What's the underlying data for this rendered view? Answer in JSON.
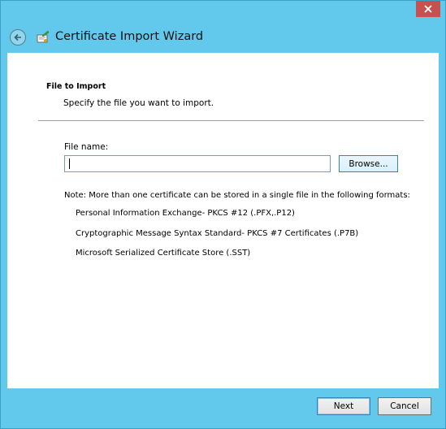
{
  "window": {
    "title": "Certificate Import Wizard",
    "close_icon": "close-icon",
    "close_color": "#c75050",
    "chrome_color": "#63c9ec"
  },
  "page": {
    "section_title": "File to Import",
    "section_desc": "Specify the file you want to import.",
    "file_label": "File name:",
    "file_value": "",
    "browse_label": "Browse...",
    "note": "Note:  More than one certificate can be stored in a single file in the following formats:",
    "formats": [
      "Personal Information Exchange- PKCS #12 (.PFX,.P12)",
      "Cryptographic Message Syntax Standard- PKCS #7 Certificates (.P7B)",
      "Microsoft Serialized Certificate Store (.SST)"
    ]
  },
  "footer": {
    "next_label": "Next",
    "cancel_label": "Cancel"
  }
}
